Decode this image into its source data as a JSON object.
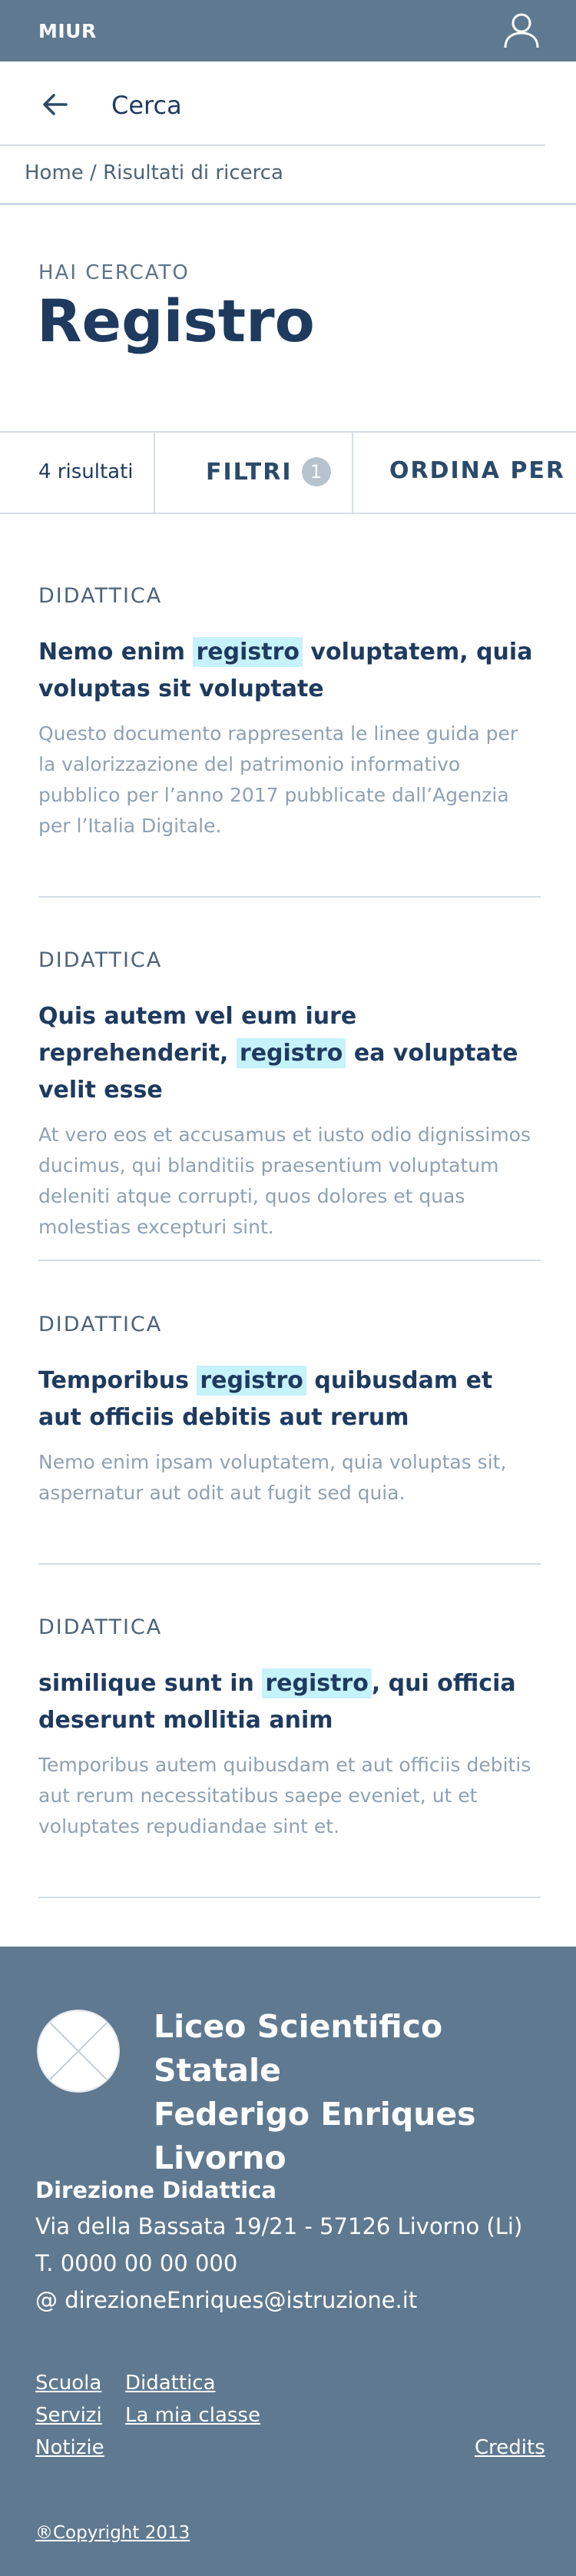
{
  "topbar": {
    "brand": "MIUR",
    "user_icon": "user-icon"
  },
  "search": {
    "back_icon": "arrow-left-icon",
    "title": "Cerca"
  },
  "breadcrumb": {
    "home": "Home",
    "separator": " / ",
    "current": "Risultati di ricerca"
  },
  "query": {
    "label": "HAI CERCATO",
    "term": "Registro"
  },
  "toolbar": {
    "count": "4 risultati",
    "filters": "FILTRI",
    "filters_badge": "1",
    "sort": "ORDINA PER"
  },
  "results": [
    {
      "category": "DIDATTICA",
      "title_before": "Nemo enim ",
      "title_highlight": "registro",
      "title_after": " voluptatem, quia voluptas sit voluptate",
      "description": "Questo documento rappresenta le linee guida per la valorizzazione del patrimonio informativo pubblico per l’anno 2017 pubblicate dall’Agenzia per l’Italia Digitale."
    },
    {
      "category": "DIDATTICA",
      "title_before": "Quis autem vel eum iure reprehenderit, ",
      "title_highlight": "registro",
      "title_after": " ea voluptate velit esse",
      "description": "At vero eos et accusamus et iusto odio dignissimos ducimus, qui blanditiis praesentium voluptatum deleniti atque corrupti, quos dolores et quas molestias excepturi sint."
    },
    {
      "category": "DIDATTICA",
      "title_before": "Temporibus ",
      "title_highlight": "registro",
      "title_after": " quibusdam et aut officiis debitis aut rerum",
      "description": "Nemo enim ipsam voluptatem, quia voluptas sit, aspernatur aut odit aut fugit sed quia."
    },
    {
      "category": "DIDATTICA",
      "title_before": "similique sunt in ",
      "title_highlight": "registro",
      "title_after": ", qui officia deserunt mollitia anim",
      "description": "Temporibus autem quibusdam et aut officiis debitis aut rerum necessitatibus saepe eveniet, ut et voluptates repudiandae sint et."
    }
  ],
  "footer": {
    "school_line1": "Liceo Scientifico Statale",
    "school_line2": "Federigo Enriques",
    "school_line3": "Livorno",
    "office": "Direzione Didattica",
    "address": "Via della Bassata 19/21 - 57126 Livorno (Li)",
    "phone": "T. 0000 00 00 000",
    "email": "@ direzioneEnriques@istruzione.it",
    "links": {
      "scuola": "Scuola",
      "didattica": "Didattica",
      "servizi": "Servizi",
      "la_mia_classe": "La mia classe",
      "notizie": "Notizie",
      "credits": "Credits"
    },
    "copyright": "®Copyright 2013"
  },
  "colors": {
    "primary": "#5f7990",
    "text": "#1e3a5f",
    "highlight": "#c6f2fb",
    "muted": "#8fa1b3"
  }
}
